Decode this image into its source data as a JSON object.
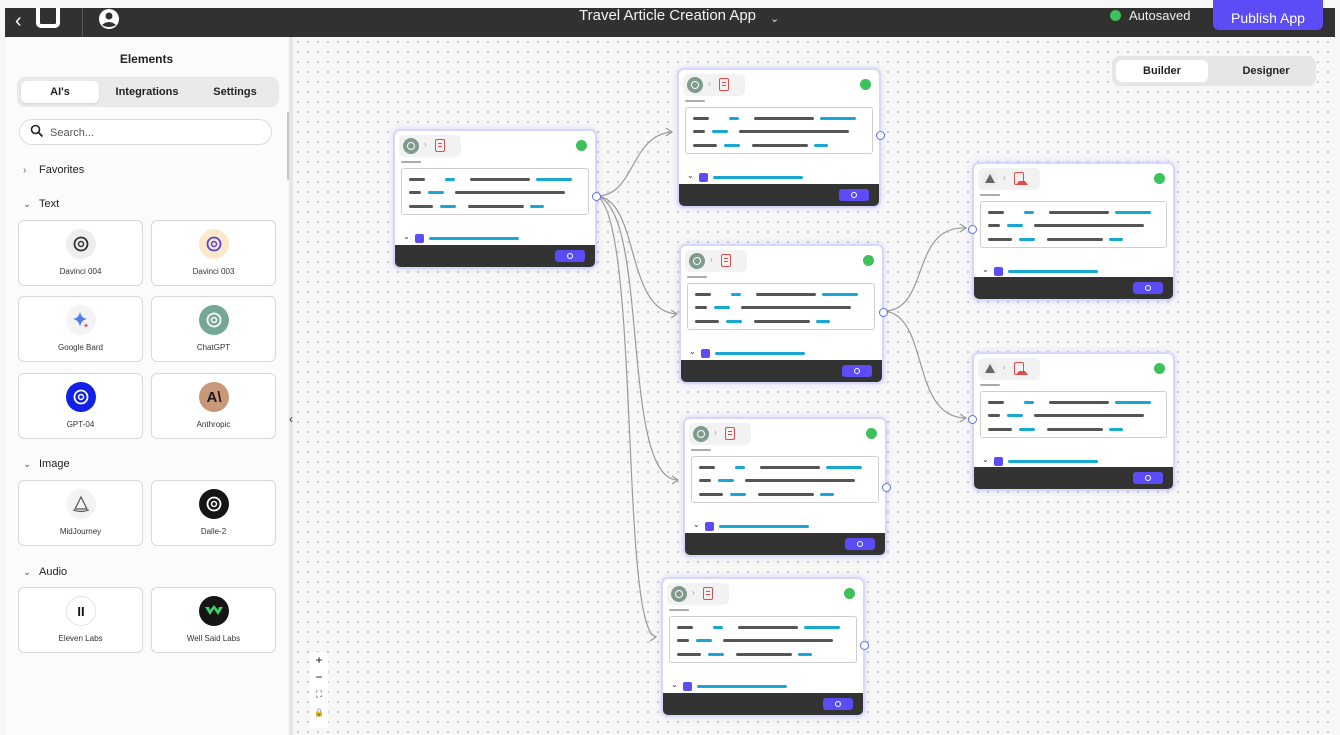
{
  "header": {
    "title": "Travel Article Creation App",
    "status": "Autosaved",
    "publish_label": "Publish App"
  },
  "sidebar": {
    "title": "Elements",
    "tabs": [
      "AI's",
      "Integrations",
      "Settings"
    ],
    "active_tab": "AI's",
    "search_placeholder": "Search...",
    "sections": {
      "favorites": "Favorites",
      "text": "Text",
      "image": "Image",
      "audio": "Audio"
    },
    "text_items": [
      "Davinci 004",
      "Davinci 003",
      "Google Bard",
      "ChatGPT",
      "GPT-04",
      "Anthropic"
    ],
    "image_items": [
      "MidJourney",
      "Dalle-2"
    ],
    "audio_items": [
      "Eleven Labs",
      "Well Said Labs"
    ],
    "anthropic_glyph": "A\\",
    "elevenlabs_glyph": "II"
  },
  "canvas": {
    "view_modes": [
      "Builder",
      "Designer"
    ],
    "active_view": "Builder",
    "zoom_controls": [
      "+",
      "−",
      "⛶",
      "🔒"
    ],
    "colors": {
      "accent": "#5b4cf5",
      "success": "#3cc15b",
      "link": "#17a8d4",
      "bar": "#333333"
    }
  }
}
